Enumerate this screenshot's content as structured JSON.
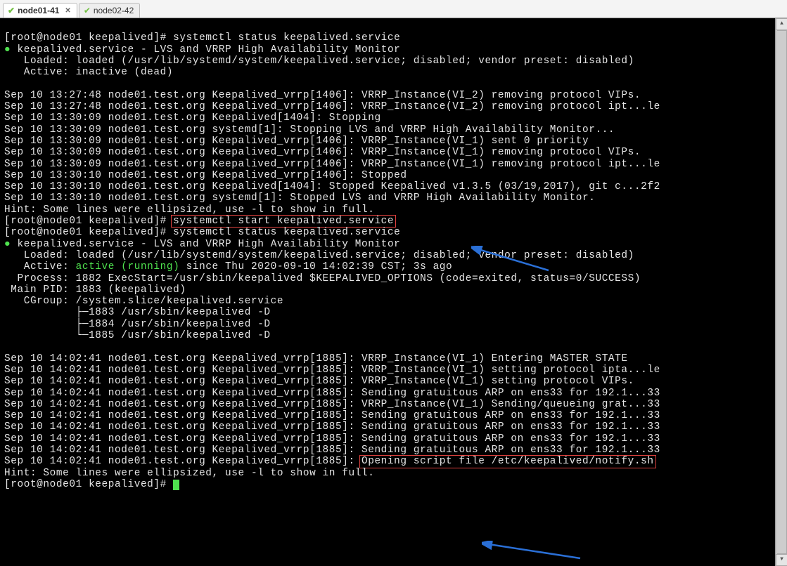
{
  "tabs": [
    {
      "label": "node01-41",
      "active": true
    },
    {
      "label": "node02-42",
      "active": false
    }
  ],
  "prompt1": "[root@node01 keepalived]# ",
  "cmd_status1": "systemctl status keepalived.service",
  "svc_line1": "keepalived.service - LVS and VRRP High Availability Monitor",
  "loaded1": "   Loaded: loaded (/usr/lib/systemd/system/keepalived.service; disabled; vendor preset: disabled)",
  "active1": "   Active: inactive (dead)",
  "log1": [
    "Sep 10 13:27:48 node01.test.org Keepalived_vrrp[1406]: VRRP_Instance(VI_2) removing protocol VIPs.",
    "Sep 10 13:27:48 node01.test.org Keepalived_vrrp[1406]: VRRP_Instance(VI_2) removing protocol ipt...le",
    "Sep 10 13:30:09 node01.test.org Keepalived[1404]: Stopping",
    "Sep 10 13:30:09 node01.test.org systemd[1]: Stopping LVS and VRRP High Availability Monitor...",
    "Sep 10 13:30:09 node01.test.org Keepalived_vrrp[1406]: VRRP_Instance(VI_1) sent 0 priority",
    "Sep 10 13:30:09 node01.test.org Keepalived_vrrp[1406]: VRRP_Instance(VI_1) removing protocol VIPs.",
    "Sep 10 13:30:09 node01.test.org Keepalived_vrrp[1406]: VRRP_Instance(VI_1) removing protocol ipt...le",
    "Sep 10 13:30:10 node01.test.org Keepalived_vrrp[1406]: Stopped",
    "Sep 10 13:30:10 node01.test.org Keepalived[1404]: Stopped Keepalived v1.3.5 (03/19,2017), git c...2f2",
    "Sep 10 13:30:10 node01.test.org systemd[1]: Stopped LVS and VRRP High Availability Monitor."
  ],
  "hint1": "Hint: Some lines were ellipsized, use -l to show in full.",
  "cmd_start": "systemctl start keepalived.service",
  "cmd_status2": "systemctl status keepalived.service",
  "svc_line2": "keepalived.service - LVS and VRRP High Availability Monitor",
  "loaded2": "   Loaded: loaded (/usr/lib/systemd/system/keepalived.service; disabled; vendor preset: disabled)",
  "active2_label": "   Active: ",
  "active2_state": "active (running)",
  "active2_since": " since Thu 2020-09-10 14:02:39 CST; 3s ago",
  "process2": "  Process: 1882 ExecStart=/usr/sbin/keepalived $KEEPALIVED_OPTIONS (code=exited, status=0/SUCCESS)",
  "mainpid2": " Main PID: 1883 (keepalived)",
  "cgroup2": "   CGroup: /system.slice/keepalived.service",
  "cg1": "           ├─1883 /usr/sbin/keepalived -D",
  "cg2": "           ├─1884 /usr/sbin/keepalived -D",
  "cg3": "           └─1885 /usr/sbin/keepalived -D",
  "log2": [
    "Sep 10 14:02:41 node01.test.org Keepalived_vrrp[1885]: VRRP_Instance(VI_1) Entering MASTER STATE",
    "Sep 10 14:02:41 node01.test.org Keepalived_vrrp[1885]: VRRP_Instance(VI_1) setting protocol ipta...le",
    "Sep 10 14:02:41 node01.test.org Keepalived_vrrp[1885]: VRRP_Instance(VI_1) setting protocol VIPs.",
    "Sep 10 14:02:41 node01.test.org Keepalived_vrrp[1885]: Sending gratuitous ARP on ens33 for 192.1...33",
    "Sep 10 14:02:41 node01.test.org Keepalived_vrrp[1885]: VRRP_Instance(VI_1) Sending/queueing grat...33",
    "Sep 10 14:02:41 node01.test.org Keepalived_vrrp[1885]: Sending gratuitous ARP on ens33 for 192.1...33",
    "Sep 10 14:02:41 node01.test.org Keepalived_vrrp[1885]: Sending gratuitous ARP on ens33 for 192.1...33",
    "Sep 10 14:02:41 node01.test.org Keepalived_vrrp[1885]: Sending gratuitous ARP on ens33 for 192.1...33",
    "Sep 10 14:02:41 node01.test.org Keepalived_vrrp[1885]: Sending gratuitous ARP on ens33 for 192.1...33"
  ],
  "log2_last_prefix": "Sep 10 14:02:41 node01.test.org Keepalived_vrrp[1885]: ",
  "log2_last_box": "Opening script file /etc/keepalived/notify.sh",
  "hint2": "Hint: Some lines were ellipsized, use -l to show in full.",
  "prompt_final": "[root@node01 keepalived]# "
}
